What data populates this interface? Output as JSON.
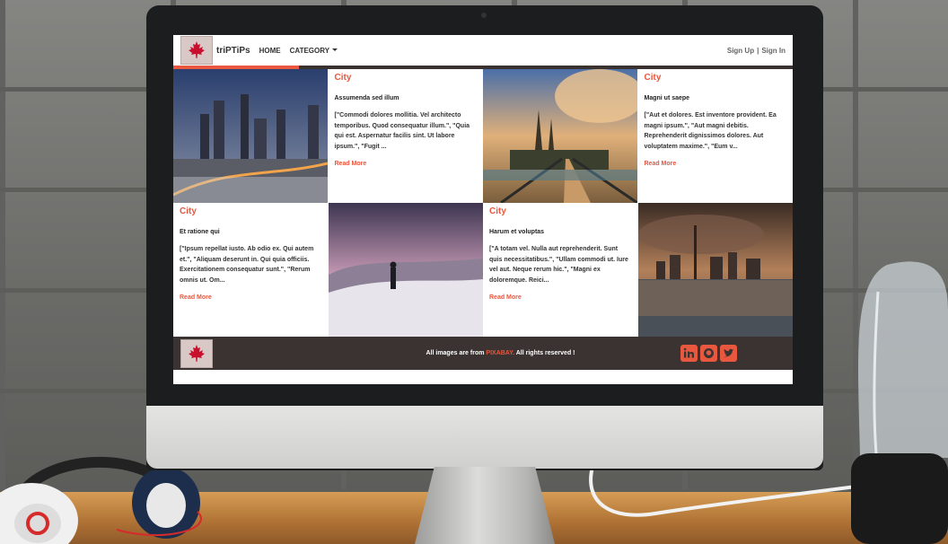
{
  "site": {
    "brand": "triPTiPs",
    "nav": {
      "home": "HOME",
      "category": "CATEGORY",
      "sign_up": "Sign Up",
      "separator": "|",
      "sign_in": "Sign In"
    },
    "colors": {
      "accent": "#e8573e",
      "dark": "#3b3331"
    }
  },
  "cards": [
    {
      "category": "City",
      "title": "Assumenda sed illum",
      "text": "[\"Commodi dolores mollitia. Vel architecto temporibus. Quod consequatur illum.\", \"Quia qui est. Aspernatur facilis sint. Ut labore ipsum.\", \"Fugit ...",
      "more": "Read More"
    },
    {
      "category": "City",
      "title": "Magni ut saepe",
      "text": "[\"Aut et dolores. Est inventore provident. Ea magni ipsum.\", \"Aut magni debitis. Reprehenderit dignissimos dolores. Aut voluptatem maxime.\", \"Eum v...",
      "more": "Read More"
    },
    {
      "category": "City",
      "title": "Et ratione qui",
      "text": "[\"Ipsum repellat iusto. Ab odio ex. Qui autem et.\", \"Aliquam deserunt in. Qui quia officiis. Exercitationem consequatur sunt.\", \"Rerum omnis ut. Om...",
      "more": "Read More"
    },
    {
      "category": "City",
      "title": "Harum et voluptas",
      "text": "[\"A totam vel. Nulla aut reprehenderit. Sunt quis necessitatibus.\", \"Ullam commodi ut. Iure vel aut. Neque rerum hic.\", \"Magni ex doloremque. Reici...",
      "more": "Read More"
    }
  ],
  "images": [
    "city-skyline-night-photo",
    "bridge-sunset-photo",
    "snow-mountain-hiker-photo",
    "toronto-skyline-reflection-photo"
  ],
  "footer": {
    "credit_prefix": "All images are from",
    "credit_source": "PIXABAY.",
    "credit_suffix": "All rights reserved !",
    "social_icons": [
      "linkedin-icon",
      "github-icon",
      "twitter-icon"
    ]
  }
}
